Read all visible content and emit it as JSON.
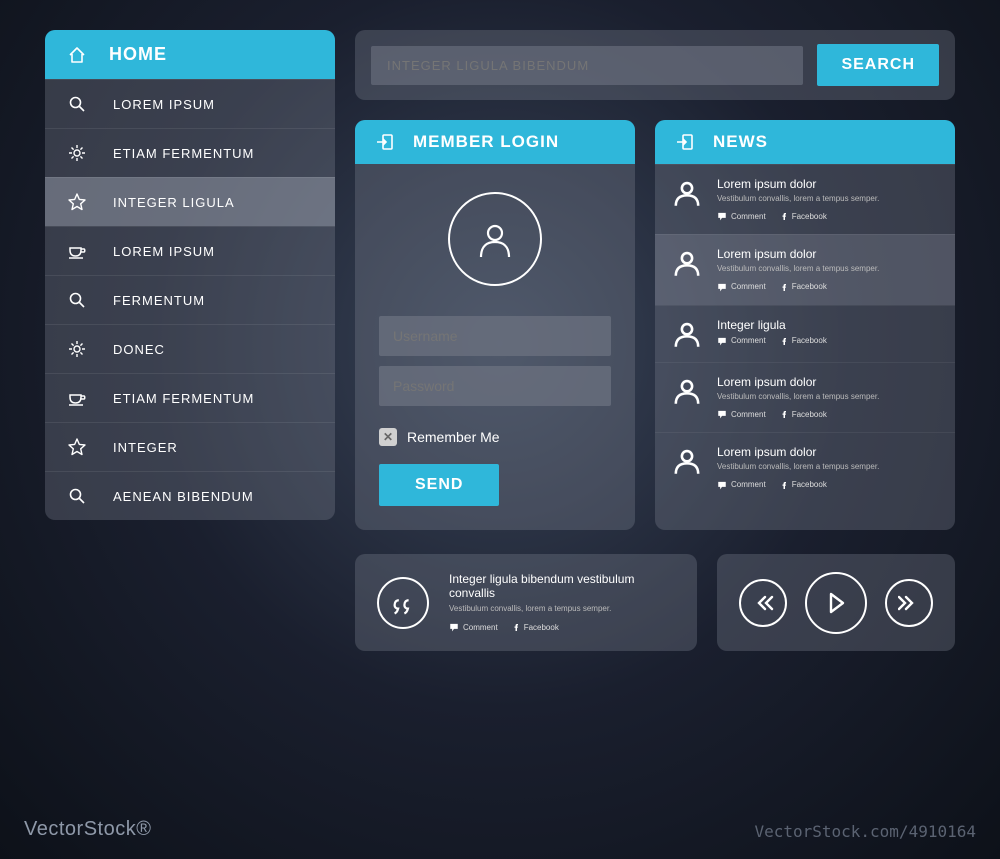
{
  "sidebar": {
    "header": "HOME",
    "items": [
      {
        "icon": "search",
        "label": "LOREM IPSUM"
      },
      {
        "icon": "gear",
        "label": "ETIAM FERMENTUM"
      },
      {
        "icon": "star",
        "label": "INTEGER LIGULA",
        "active": true
      },
      {
        "icon": "cup",
        "label": "LOREM IPSUM"
      },
      {
        "icon": "search",
        "label": "FERMENTUM"
      },
      {
        "icon": "gear",
        "label": "DONEC"
      },
      {
        "icon": "cup",
        "label": "ETIAM FERMENTUM"
      },
      {
        "icon": "star",
        "label": "INTEGER"
      },
      {
        "icon": "search",
        "label": "AENEAN BIBENDUM"
      }
    ]
  },
  "search": {
    "placeholder": "INTEGER LIGULA BIBENDUM",
    "button": "SEARCH"
  },
  "login": {
    "header": "MEMBER LOGIN",
    "username_placeholder": "Username",
    "password_placeholder": "Password",
    "remember": "Remember Me",
    "send": "SEND"
  },
  "news": {
    "header": "NEWS",
    "items": [
      {
        "title": "Lorem ipsum dolor",
        "sub": "Vestibulum convallis, lorem a tempus semper.",
        "comment": "Comment",
        "facebook": "Facebook"
      },
      {
        "title": "Lorem ipsum dolor",
        "sub": "Vestibulum convallis, lorem a tempus semper.",
        "comment": "Comment",
        "facebook": "Facebook"
      },
      {
        "title": "Integer ligula",
        "sub": "",
        "comment": "Comment",
        "facebook": "Facebook"
      },
      {
        "title": "Lorem ipsum dolor",
        "sub": "Vestibulum convallis, lorem a tempus semper.",
        "comment": "Comment",
        "facebook": "Facebook"
      },
      {
        "title": "Lorem ipsum dolor",
        "sub": "Vestibulum convallis, lorem a tempus semper.",
        "comment": "Comment",
        "facebook": "Facebook"
      }
    ]
  },
  "quote": {
    "title": "Integer ligula bibendum vestibulum convallis",
    "sub": "Vestibulum convallis, lorem a tempus semper.",
    "comment": "Comment",
    "facebook": "Facebook"
  },
  "watermark": {
    "left": "VectorStock®",
    "right": "VectorStock.com/4910164"
  },
  "colors": {
    "accent": "#2fb7da"
  }
}
